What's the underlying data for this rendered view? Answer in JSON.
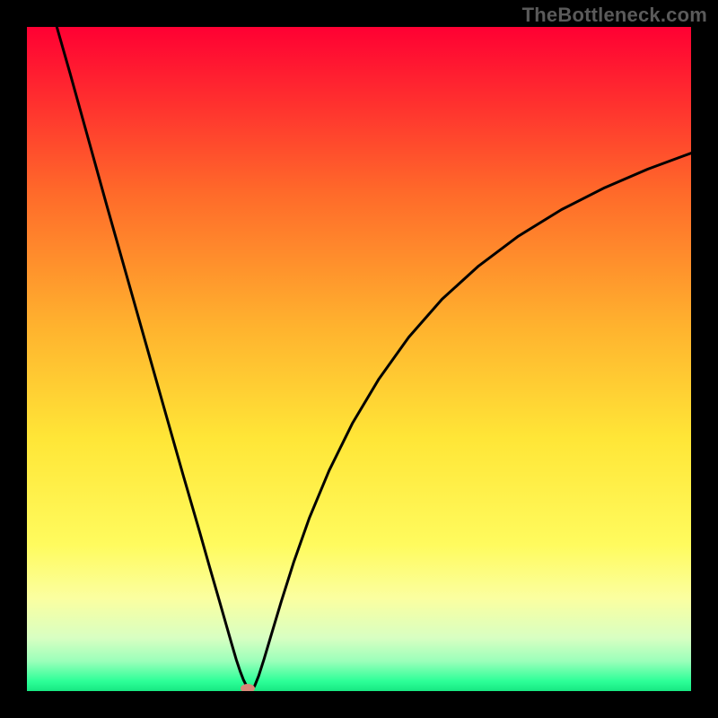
{
  "watermark": "TheBottleneck.com",
  "chart_data": {
    "type": "line",
    "title": "",
    "xlabel": "",
    "ylabel": "",
    "xlim": [
      0,
      100
    ],
    "ylim": [
      0,
      100
    ],
    "gradient_stops": [
      {
        "offset": 0.0,
        "color": "#ff0033"
      },
      {
        "offset": 0.1,
        "color": "#ff2a2f"
      },
      {
        "offset": 0.25,
        "color": "#ff6a2a"
      },
      {
        "offset": 0.45,
        "color": "#ffb22e"
      },
      {
        "offset": 0.62,
        "color": "#ffe637"
      },
      {
        "offset": 0.78,
        "color": "#fffb5e"
      },
      {
        "offset": 0.86,
        "color": "#fbffa0"
      },
      {
        "offset": 0.92,
        "color": "#d8ffc2"
      },
      {
        "offset": 0.955,
        "color": "#9bffba"
      },
      {
        "offset": 0.985,
        "color": "#2dff98"
      },
      {
        "offset": 1.0,
        "color": "#17e882"
      }
    ],
    "series": [
      {
        "name": "curve",
        "color": "#000000",
        "width": 3,
        "points": [
          [
            4.5,
            100.0
          ],
          [
            6.5,
            93.0
          ],
          [
            9.0,
            84.0
          ],
          [
            12.0,
            73.2
          ],
          [
            15.0,
            62.6
          ],
          [
            18.0,
            52.0
          ],
          [
            21.0,
            41.4
          ],
          [
            23.5,
            32.6
          ],
          [
            26.0,
            24.0
          ],
          [
            27.5,
            18.7
          ],
          [
            29.0,
            13.5
          ],
          [
            30.0,
            10.0
          ],
          [
            30.8,
            7.2
          ],
          [
            31.5,
            4.8
          ],
          [
            32.1,
            3.0
          ],
          [
            32.6,
            1.7
          ],
          [
            33.05,
            0.8
          ],
          [
            33.35,
            0.3
          ],
          [
            33.6,
            0.05
          ],
          [
            33.9,
            0.15
          ],
          [
            34.3,
            0.8
          ],
          [
            34.9,
            2.3
          ],
          [
            35.7,
            4.8
          ],
          [
            36.8,
            8.5
          ],
          [
            38.3,
            13.5
          ],
          [
            40.2,
            19.5
          ],
          [
            42.5,
            26.0
          ],
          [
            45.5,
            33.2
          ],
          [
            49.0,
            40.3
          ],
          [
            53.0,
            47.0
          ],
          [
            57.5,
            53.3
          ],
          [
            62.5,
            59.0
          ],
          [
            68.0,
            64.0
          ],
          [
            74.0,
            68.5
          ],
          [
            80.5,
            72.5
          ],
          [
            87.0,
            75.8
          ],
          [
            93.5,
            78.6
          ],
          [
            100.0,
            81.0
          ]
        ]
      }
    ],
    "marker": {
      "x": 33.2,
      "y": 0.4,
      "color": "#d88878"
    }
  },
  "colors": {
    "frame": "#000000",
    "curve": "#000000",
    "marker": "#d88878"
  }
}
